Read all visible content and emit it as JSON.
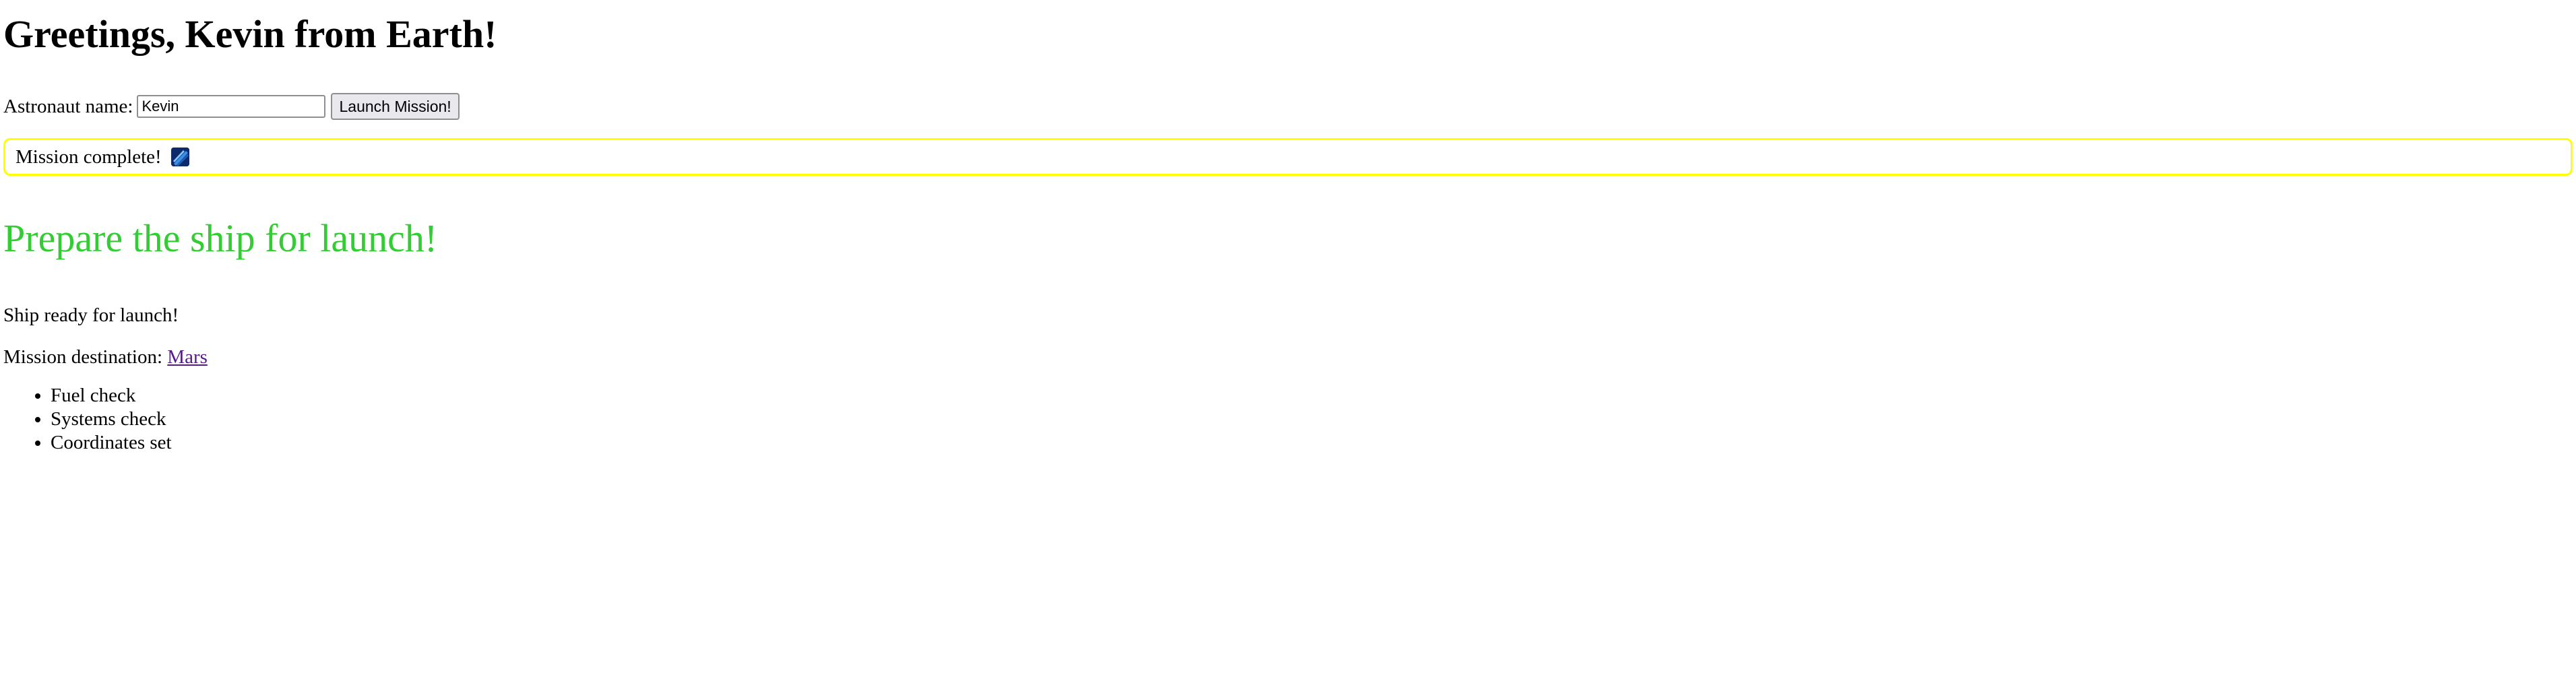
{
  "header": {
    "greeting": "Greetings, Kevin from Earth!"
  },
  "form": {
    "name_label": "Astronaut name:",
    "name_value": "Kevin",
    "launch_button_label": "Launch Mission!"
  },
  "mission_box": {
    "text": "Mission complete!",
    "border_color": "#ffff00",
    "icon": "rocket-icon"
  },
  "main": {
    "heading": "Prepare the ship for launch!",
    "heading_color": "#32cd32",
    "status_text": "Ship ready for launch!",
    "destination_label": "Mission destination:",
    "destination_link": "Mars",
    "checklist": [
      "Fuel check",
      "Systems check",
      "Coordinates set"
    ]
  }
}
